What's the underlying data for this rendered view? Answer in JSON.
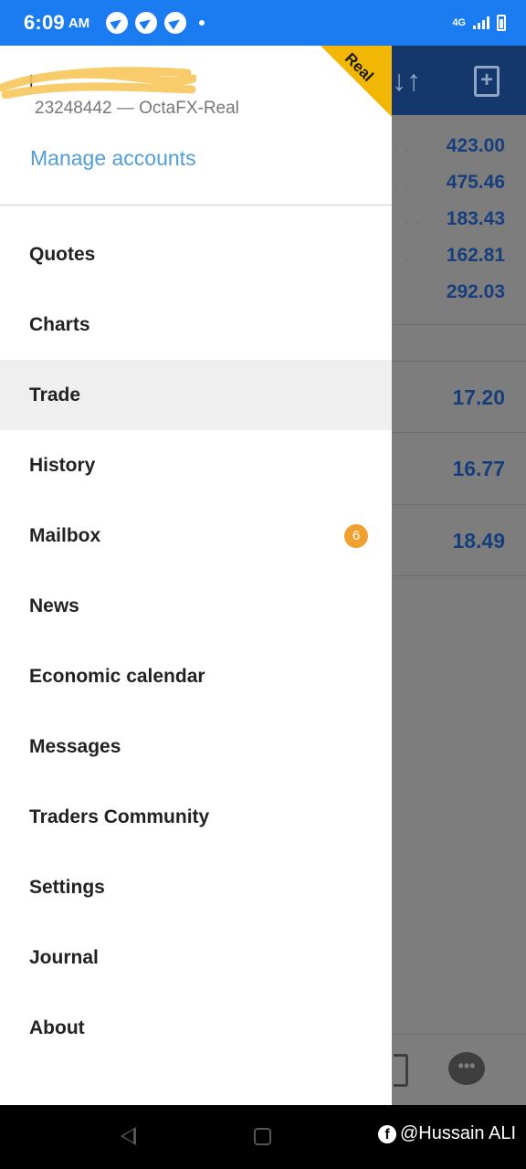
{
  "status_bar": {
    "time": "6:09",
    "ampm": "AM",
    "network": "4G"
  },
  "account": {
    "name": "l",
    "subtitle": "23248442 — OctaFX-Real",
    "manage_link": "Manage accounts",
    "ribbon_label": "Real"
  },
  "menu": {
    "items": [
      {
        "label": "Quotes"
      },
      {
        "label": "Charts"
      },
      {
        "label": "Trade",
        "active": true
      },
      {
        "label": "History"
      },
      {
        "label": "Mailbox",
        "badge": "6"
      },
      {
        "label": "News"
      },
      {
        "label": "Economic calendar"
      },
      {
        "label": "Messages"
      },
      {
        "label": "Traders Community"
      },
      {
        "label": "Settings"
      },
      {
        "label": "Journal"
      },
      {
        "label": "About"
      }
    ]
  },
  "background_app": {
    "quotes": [
      "423.00",
      "475.46",
      "183.43",
      "162.81",
      "292.03"
    ],
    "prices": [
      "17.20",
      "16.77",
      "18.49"
    ]
  },
  "watermark": {
    "text": "@Hussain ALI"
  },
  "colors": {
    "status_bar": "#1a7cf0",
    "link": "#4f9ed9",
    "ribbon": "#f2b705",
    "badge": "#f0a02e",
    "price_text": "#173e7c"
  }
}
